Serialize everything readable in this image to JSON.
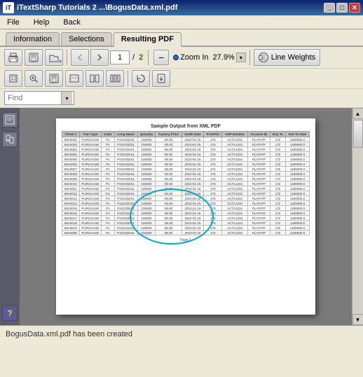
{
  "window": {
    "title": "iTextSharp Tutorials 2 ...\\BogusData.xml.pdf",
    "icon_label": "iT"
  },
  "menu": {
    "items": [
      "File",
      "Help",
      "Back"
    ]
  },
  "tabs": [
    {
      "label": "Information",
      "active": false
    },
    {
      "label": "Selections",
      "active": false
    },
    {
      "label": "Resulting PDF",
      "active": true
    }
  ],
  "toolbar1": {
    "page_current": "1",
    "page_total": "2",
    "zoom_label": "Zoom In",
    "zoom_value": "27.9%",
    "line_weights_label": "Line Weights"
  },
  "find": {
    "placeholder": "Find",
    "value": ""
  },
  "pdf": {
    "title": "Sample Output from XML PDF",
    "page_label": "Page 1"
  },
  "status": {
    "message": "BogusData.xml.pdf has been created"
  },
  "table": {
    "headers": [
      "Check #",
      "Tran Type",
      "Color",
      "Long Name",
      "Quantity",
      "Factory Price",
      "Settle Date",
      "Priv/Prio",
      "ADP Number",
      "Account ID",
      "Buy To",
      "Inst To Date"
    ],
    "rows": [
      [
        "88A0001",
        "PURCHASE",
        "P1",
        "P1GOODS1",
        "100000",
        "90.00",
        "2010-01-15",
        "175",
        "ACTA1234",
        "PLATATP",
        "172",
        "1190000.0"
      ],
      [
        "88A0002",
        "PURCHASE",
        "P1",
        "P1GOODS1",
        "100000",
        "90.00",
        "2010-01-15",
        "175",
        "ACTA1234",
        "PLATATP",
        "172",
        "1190000.0"
      ],
      [
        "88A0003",
        "PURCHASE",
        "P1",
        "P1GOODS1",
        "100000",
        "90.00",
        "2010-01-15",
        "175",
        "ACTA1234",
        "PLATATP",
        "172",
        "1190000.0"
      ],
      [
        "88A0004",
        "PURCHASE",
        "P1",
        "P1GOODS1",
        "100000",
        "90.00",
        "2010-01-15",
        "175",
        "ACTA1234",
        "PLATATP",
        "172",
        "1190000.0"
      ],
      [
        "88A0005",
        "PURCHASE",
        "P1",
        "P1GOODS1",
        "100000",
        "90.00",
        "2010-01-15",
        "175",
        "ACTA1234",
        "PLATATP",
        "172",
        "1190000.0"
      ],
      [
        "88A0006",
        "PURCHASE",
        "P1",
        "P1GOODS1",
        "100000",
        "90.00",
        "2010-01-15",
        "175",
        "ACTA1234",
        "PLATATP",
        "172",
        "1190000.0"
      ],
      [
        "88A0007",
        "PURCHASE",
        "P1",
        "P1GOODS1",
        "100000",
        "90.00",
        "2010-01-15",
        "175",
        "ACTA1234",
        "PLATATP",
        "172",
        "1190000.0"
      ],
      [
        "88A0008",
        "PURCHASE",
        "P1",
        "P1GOODS1",
        "100000",
        "90.00",
        "2010-01-15",
        "175",
        "ACTA1234",
        "PLATATP",
        "172",
        "1190000.0"
      ],
      [
        "88A0009",
        "PURCHASE",
        "P1",
        "P1GOODS1",
        "100000",
        "90.00",
        "2010-01-15",
        "175",
        "ACTA1234",
        "PLATATP",
        "172",
        "1190000.0"
      ],
      [
        "88A0010",
        "PURCHASE",
        "P1",
        "P1GOODS1",
        "100000",
        "90.00",
        "2010-01-15",
        "175",
        "ACTA1234",
        "PLATATP",
        "172",
        "1190000.0"
      ],
      [
        "88A0011",
        "PURCHASE",
        "P1",
        "P1GOODS1",
        "100000",
        "90.00",
        "2010-01-15",
        "175",
        "ACTA1234",
        "PLATATP",
        "172",
        "1190000.0"
      ],
      [
        "88A0012",
        "PURCHASE",
        "P1",
        "P1GOODS1",
        "100000",
        "90.00",
        "2010-01-15",
        "175",
        "ACTA1234",
        "PLATATP",
        "172",
        "1190000.0"
      ],
      [
        "88A0013",
        "PURCHASE",
        "P1",
        "P1GOODS1",
        "100000",
        "90.00",
        "2010-01-15",
        "175",
        "ACTA1234",
        "PLATATP",
        "172",
        "1190000.0"
      ],
      [
        "88A0014",
        "PURCHASE",
        "P1",
        "P1GOODS1",
        "100000",
        "90.00",
        "2010-01-15",
        "175",
        "ACTA1234",
        "PLATATP",
        "172",
        "1190000.0"
      ],
      [
        "88A0015",
        "PURCHASE",
        "P1",
        "P1GOODS1",
        "100000",
        "90.00",
        "2010-01-15",
        "175",
        "ACTA1234",
        "PLATATP",
        "172",
        "1190000.0"
      ],
      [
        "88A0016",
        "PURCHASE",
        "P1",
        "P1GOODS1",
        "100000",
        "90.00",
        "2010-01-15",
        "175",
        "ACTA1234",
        "PLATATP",
        "172",
        "1190000.0"
      ],
      [
        "88A0017",
        "PURCHASE",
        "P1",
        "P1GOODS1",
        "100000",
        "90.00",
        "2010-01-15",
        "175",
        "ACTA1234",
        "PLATATP",
        "172",
        "1190000.0"
      ],
      [
        "88A0018",
        "PURCHASE",
        "P1",
        "P1GOODS1",
        "100000",
        "90.00",
        "2010-01-15",
        "175",
        "ACTA1234",
        "PLATATP",
        "172",
        "1190000.0"
      ],
      [
        "88A0019",
        "PURCHASE",
        "P1",
        "P1GOODS1",
        "100000",
        "90.00",
        "2010-01-15",
        "175",
        "ACTA1234",
        "PLATATP",
        "172",
        "1190000.0"
      ],
      [
        "88A0020",
        "PURCHASE",
        "P1",
        "P1GOODS1",
        "100000",
        "90.00",
        "2010-01-15",
        "175",
        "ACTA1234",
        "PLATATP",
        "172",
        "1190000.0"
      ]
    ]
  }
}
